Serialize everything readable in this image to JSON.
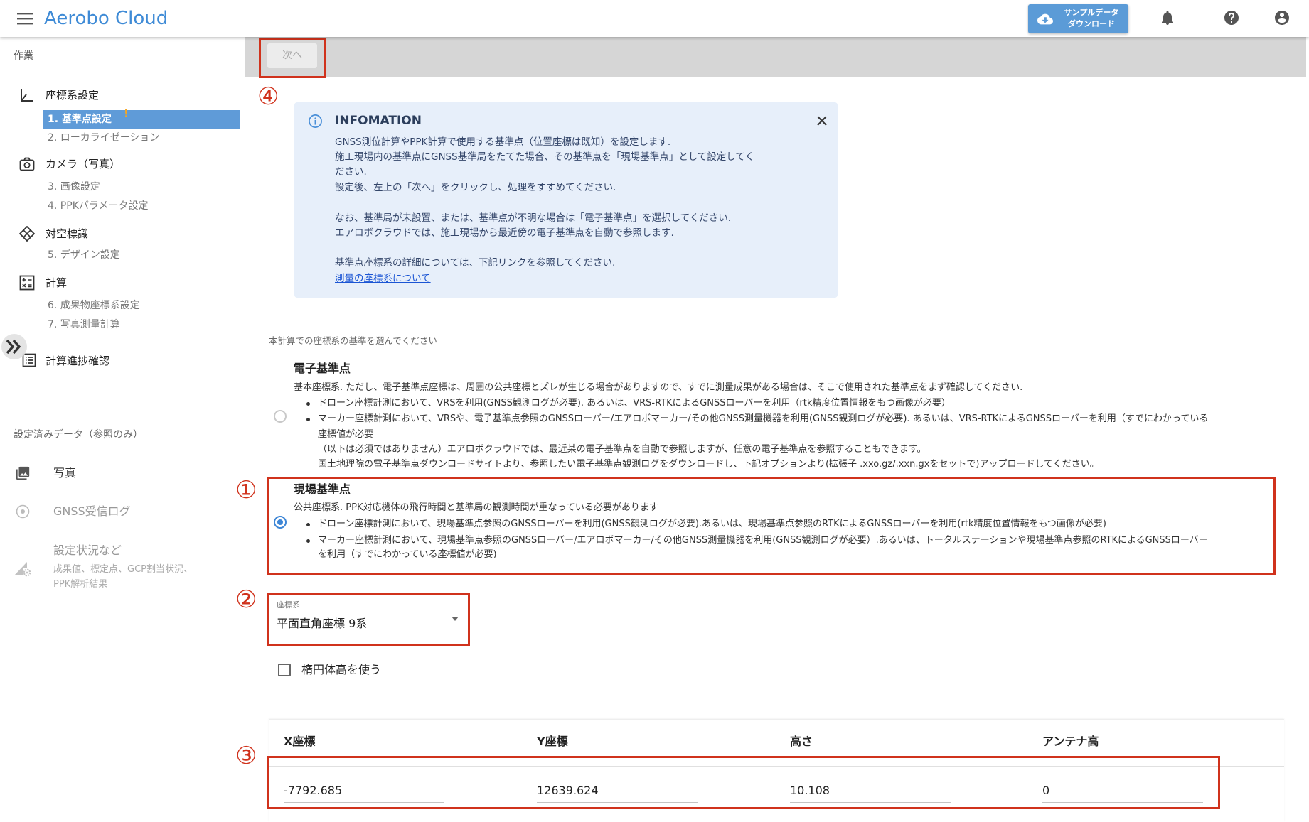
{
  "app": {
    "title": "Aerobo Cloud"
  },
  "header": {
    "download_button": {
      "line1": "サンプルデータ",
      "line2": "ダウンロード"
    },
    "icons": [
      "menu-icon",
      "cloud-download-icon",
      "notifications-icon",
      "help-icon",
      "account-icon"
    ]
  },
  "theme": {
    "accent": "#3f8bd6",
    "active_item": "#5f9bd8",
    "warning": "#f5a623",
    "annotation": "#d0321c"
  },
  "sidebar": {
    "work_label": "作業",
    "sections": [
      {
        "icon": "axis-icon",
        "label": "座標系設定",
        "items": [
          {
            "label": "1. 基準点設定",
            "active": true,
            "warning": "!"
          },
          {
            "label": "2. ローカライゼーション"
          }
        ]
      },
      {
        "icon": "camera-icon",
        "label": "カメラ（写真）",
        "items": [
          {
            "label": "3. 画像設定"
          },
          {
            "label": "4. PPKパラメータ設定"
          }
        ]
      },
      {
        "icon": "target-marker-icon",
        "label": "対空標識",
        "items": [
          {
            "label": "5. デザイン設定"
          }
        ]
      },
      {
        "icon": "calculator-icon",
        "label": "計算",
        "items": [
          {
            "label": "6. 成果物座標系設定"
          },
          {
            "label": "7. 写真測量計算"
          }
        ]
      }
    ],
    "progress_label": "計算進捗確認",
    "reference": {
      "heading": "設定済みデータ（参照のみ）",
      "items": [
        {
          "icon": "photo-library-icon",
          "label": "写真"
        },
        {
          "icon": "gnss-log-icon",
          "label": "GNSS受信ログ"
        },
        {
          "icon": "settings-status-icon",
          "label": "設定状況など",
          "sub": [
            "成果値、標定点、GCP割当状況、",
            "PPK解析結果"
          ]
        }
      ]
    }
  },
  "toolbar": {
    "next_label": "次へ"
  },
  "info": {
    "title": "INFOMATION",
    "lines": [
      "GNSS測位計算やPPK計算で使用する基準点（位置座標は既知）を設定します.",
      "施工現場内の基準点にGNSS基準局をたてた場合、その基準点を「現場基準点」として設定してく",
      "ださい.",
      "設定後、左上の「次へ」をクリックし、処理をすすめてください.",
      "なお、基準局が未設置、または、基準点が不明な場合は「電子基準点」を選択してください.",
      "エアロボクラウドでは、施工現場から最近傍の電子基準点を自動で参照します.",
      "基準点座標系の詳細については、下記リンクを参照してください."
    ],
    "link": "測量の座標系について"
  },
  "form": {
    "prompt": "本計算での座標系の基準を選んでください",
    "reference_options": [
      {
        "title": "電子基準点",
        "selected": false,
        "desc": "基本座標系. ただし、電子基準点座標は、周囲の公共座標とズレが生じる場合がありますので、すでに測量成果がある場合は、そこで使用された基準点をまず確認してください.",
        "bullets": [
          {
            "lines": [
              "ドローン座標計測において、VRSを利用(GNSS観測ログが必要). あるいは、VRS-RTKによるGNSSローバーを利用（rtk精度位置情報をもつ画像が必要）"
            ]
          },
          {
            "lines": [
              "マーカー座標計測において、VRSや、電子基準点参照のGNSSローバー/エアロボマーカー/その他GNSS測量機器を利用(GNSS観測ログが必要). あるいは、VRS-RTKによるGNSSローバーを利用（すでにわかっている",
              "座標値が必要"
            ]
          }
        ],
        "notes": [
          "（以下は必須ではありません）エアロボクラウドでは、最近某の電子基準点を自動で参照しますが、任意の電子基準点を参照することもできます。",
          "国土地理院の電子基準点ダウンロードサイトより、参照したい電子基準点観測ログをダウンロードし、下記オプションより(拡張子 .xxo.gz/.xxn.gxをセットで)アップロードしてください。"
        ]
      },
      {
        "title": "現場基準点",
        "selected": true,
        "desc": "公共座標系. PPK対応機体の飛行時間と基準局の観測時間が重なっている必要があります",
        "bullets": [
          {
            "lines": [
              "ドローン座標計測において、現場基準点参照のGNSSローバーを利用(GNSS観測ログが必要).あるいは、現場基準点参照のRTKによるGNSSローバーを利用(rtk精度位置情報をもつ画像が必要)"
            ]
          },
          {
            "lines": [
              "マーカー座標計測において、現場基準点参照のGNSSローバー/エアロボマーカー/その他GNSS測量機器を利用(GNSS観測ログが必要）.あるいは、トータルステーションや現場基準点参照のRTKによるGNSSローバー",
              "を利用（すでにわかっている座標値が必要)"
            ]
          }
        ]
      }
    ],
    "coordinate_system": {
      "label": "座標系",
      "value": "平面直角座標 9系"
    },
    "ellipsoid_height": {
      "label": "楕円体高を使う",
      "checked": false
    },
    "table": {
      "headers": [
        "X座標",
        "Y座標",
        "高さ",
        "アンテナ高"
      ],
      "values": [
        "-7792.685",
        "12639.624",
        "10.108",
        "0"
      ]
    }
  },
  "annotations": [
    "①",
    "②",
    "③",
    "④"
  ]
}
